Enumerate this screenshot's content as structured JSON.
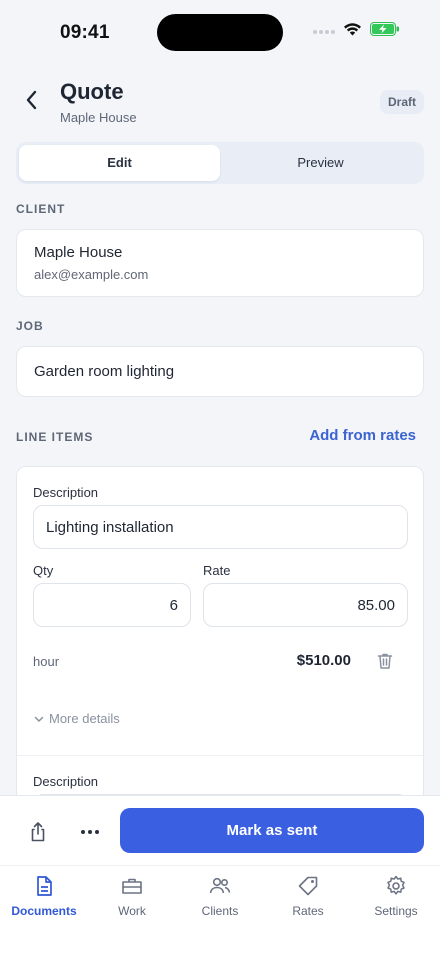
{
  "status_bar": {
    "time": "09:41"
  },
  "header": {
    "title": "Quote",
    "subtitle": "Maple House",
    "badge": "Draft"
  },
  "segments": {
    "edit": "Edit",
    "preview": "Preview"
  },
  "client": {
    "section": "CLIENT",
    "name": "Maple House",
    "email": "alex@example.com"
  },
  "job": {
    "section": "JOB",
    "value": "Garden room lighting"
  },
  "line_items": {
    "section": "LINE ITEMS",
    "add_link": "Add from rates",
    "items": [
      {
        "description_label": "Description",
        "description": "Lighting installation",
        "qty_label": "Qty",
        "qty": "6",
        "rate_label": "Rate",
        "rate": "85.00",
        "unit": "hour",
        "total": "$510.00",
        "more_details": "More details"
      },
      {
        "description_label": "Description"
      }
    ]
  },
  "actions": {
    "primary": "Mark as sent"
  },
  "tabs": [
    {
      "label": "Documents",
      "icon": "document-icon",
      "active": true
    },
    {
      "label": "Work",
      "icon": "briefcase-icon"
    },
    {
      "label": "Clients",
      "icon": "users-icon"
    },
    {
      "label": "Rates",
      "icon": "tag-icon"
    },
    {
      "label": "Settings",
      "icon": "gear-icon"
    }
  ],
  "colors": {
    "accent": "#3a5fe0",
    "background": "#f3f5f9",
    "link": "#3b63d1"
  }
}
